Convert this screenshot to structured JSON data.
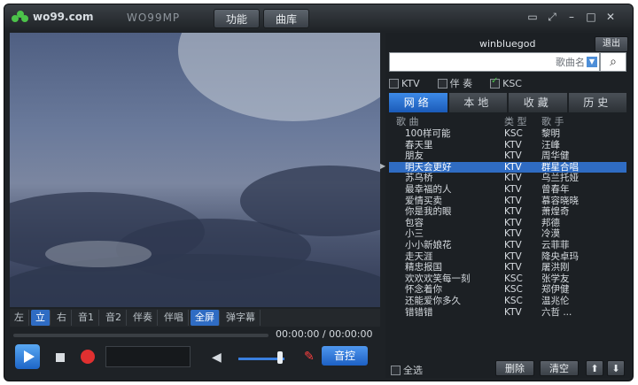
{
  "window": {
    "logo_text": "wo99.com",
    "app_name": "WO99MP",
    "top_buttons": [
      "功能",
      "曲库"
    ],
    "controls": [
      "▭",
      "⤢",
      "–",
      "□",
      "✕"
    ]
  },
  "player": {
    "control_tabs": [
      {
        "label": "左",
        "active": false
      },
      {
        "label": "立",
        "active": true
      },
      {
        "label": "右",
        "active": false
      },
      {
        "label": "音1",
        "active": false
      },
      {
        "label": "音2",
        "active": false
      },
      {
        "label": "伴奏",
        "active": false
      },
      {
        "label": "伴唱",
        "active": false
      },
      {
        "label": "全屏",
        "active": true
      },
      {
        "label": "弹字幕",
        "active": false
      }
    ],
    "time": "00:00:00 / 00:00:00",
    "audio_button": "音控",
    "volume_level": 0.9
  },
  "panel": {
    "username": "winbluegod",
    "logout_label": "退出",
    "search_placeholder": "",
    "search_mode": "歌曲名",
    "filters": [
      {
        "label": "KTV",
        "checked": false
      },
      {
        "label": "伴 奏",
        "checked": false
      },
      {
        "label": "KSC",
        "checked": true
      }
    ],
    "tabs": [
      {
        "label": "网络",
        "active": true
      },
      {
        "label": "本地",
        "active": false
      },
      {
        "label": "收藏",
        "active": false
      },
      {
        "label": "历史",
        "active": false
      }
    ],
    "list_headers": [
      "歌 曲",
      "类 型",
      "歌 手"
    ],
    "songs": [
      {
        "title": "100样可能",
        "type": "KSC",
        "artist": "黎明"
      },
      {
        "title": "春天里",
        "type": "KTV",
        "artist": "汪峰"
      },
      {
        "title": "朋友",
        "type": "KTV",
        "artist": "周华健"
      },
      {
        "title": "明天会更好",
        "type": "KTV",
        "artist": "群星合唱"
      },
      {
        "title": "苏乌桥",
        "type": "KTV",
        "artist": "乌兰托娅"
      },
      {
        "title": "最幸福的人",
        "type": "KTV",
        "artist": "曾春年"
      },
      {
        "title": "爱情买卖",
        "type": "KTV",
        "artist": "慕容晓晓"
      },
      {
        "title": "你是我的眼",
        "type": "KTV",
        "artist": "萧煌奇"
      },
      {
        "title": "包容",
        "type": "KTV",
        "artist": "邦德"
      },
      {
        "title": "小三",
        "type": "KTV",
        "artist": "冷漠"
      },
      {
        "title": "小小新娘花",
        "type": "KTV",
        "artist": "云菲菲"
      },
      {
        "title": "走天涯",
        "type": "KTV",
        "artist": "降央卓玛"
      },
      {
        "title": "精忠报国",
        "type": "KTV",
        "artist": "屠洪刚"
      },
      {
        "title": "欢欢欢笑每一刻",
        "type": "KSC",
        "artist": "张学友"
      },
      {
        "title": "怀念着你",
        "type": "KSC",
        "artist": "郑伊健"
      },
      {
        "title": "还能爱你多久",
        "type": "KSC",
        "artist": "温兆伦"
      },
      {
        "title": "错错错",
        "type": "KTV",
        "artist": "六哲 ..."
      }
    ],
    "selected_index": 3,
    "select_all_label": "全选",
    "delete_label": "删除",
    "clear_label": "清空",
    "up_label": "⬆",
    "down_label": "⬇"
  }
}
